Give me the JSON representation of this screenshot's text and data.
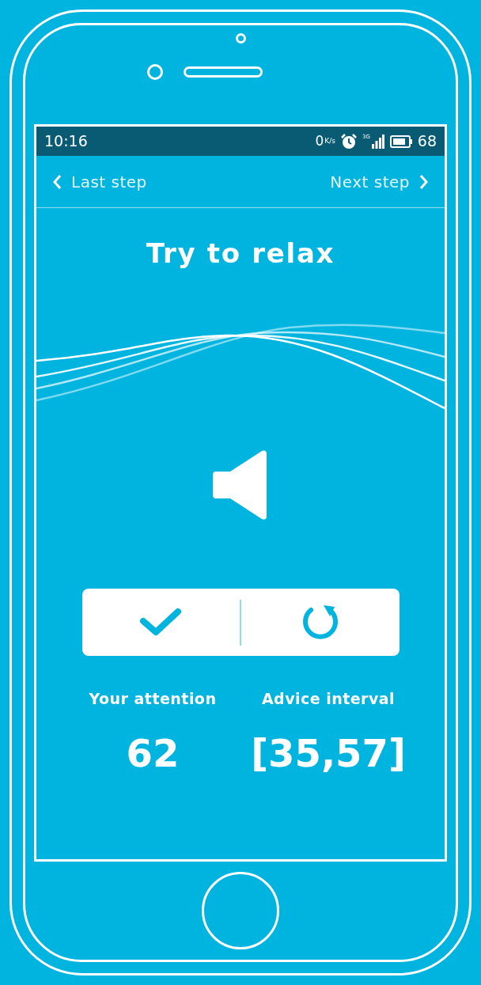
{
  "status_bar": {
    "time": "10:16",
    "speed": "0",
    "speed_unit": "K/s",
    "network": "3G",
    "battery": "68"
  },
  "nav": {
    "back": "Last step",
    "next": "Next step"
  },
  "title": "Try to relax",
  "actions": [
    {
      "kind": "confirm"
    },
    {
      "kind": "retry"
    }
  ],
  "stats": [
    {
      "label": "Your attention",
      "value": "62"
    },
    {
      "label": "Advice interval",
      "value": "[35,57]"
    }
  ]
}
